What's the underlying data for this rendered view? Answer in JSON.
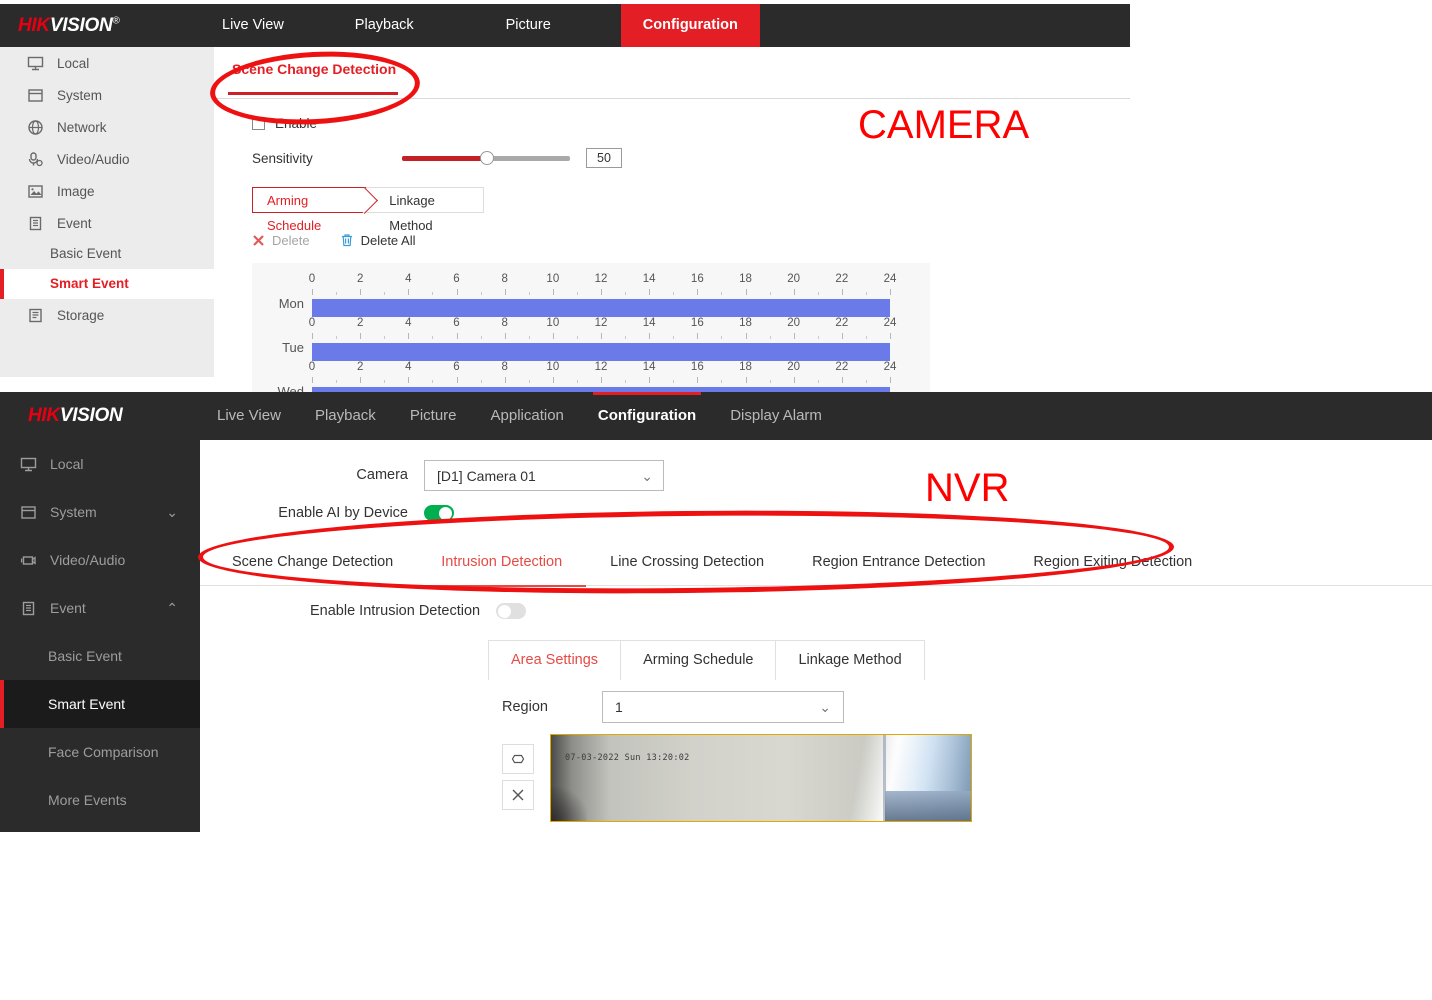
{
  "annotations": {
    "camera_label": "CAMERA",
    "nvr_label": "NVR",
    "accent_red": "#ee1111"
  },
  "camera_panel": {
    "brand": {
      "hik": "HIK",
      "vision": "VISION",
      "reg": "®"
    },
    "nav": [
      {
        "label": "Live View",
        "active": false
      },
      {
        "label": "Playback",
        "active": false
      },
      {
        "label": "Picture",
        "active": false
      },
      {
        "label": "Configuration",
        "active": true
      }
    ],
    "sidebar": [
      {
        "label": "Local",
        "icon": "monitor-icon"
      },
      {
        "label": "System",
        "icon": "window-icon"
      },
      {
        "label": "Network",
        "icon": "globe-icon"
      },
      {
        "label": "Video/Audio",
        "icon": "microphone-icon"
      },
      {
        "label": "Image",
        "icon": "picture-icon"
      },
      {
        "label": "Event",
        "icon": "clipboard-icon"
      }
    ],
    "sidebar_sub": [
      {
        "label": "Basic Event",
        "active": false
      },
      {
        "label": "Smart Event",
        "active": true
      }
    ],
    "sidebar_tail": [
      {
        "label": "Storage",
        "icon": "disk-icon"
      }
    ],
    "page_tab": "Scene Change Detection",
    "enable_label": "Enable",
    "enable_checked": false,
    "sensitivity_label": "Sensitivity",
    "sensitivity_value": "50",
    "sub_tabs": [
      {
        "label": "Arming Schedule",
        "active": true
      },
      {
        "label": "Linkage Method",
        "active": false
      }
    ],
    "actions": {
      "delete": "Delete",
      "delete_all": "Delete All"
    },
    "schedule": {
      "tick_labels": [
        "0",
        "2",
        "4",
        "6",
        "8",
        "10",
        "12",
        "14",
        "16",
        "18",
        "20",
        "22",
        "24"
      ],
      "days": [
        {
          "day": "Mon",
          "start": 0,
          "end": 24
        },
        {
          "day": "Tue",
          "start": 0,
          "end": 24
        },
        {
          "day": "Wed",
          "start": 0,
          "end": 24
        }
      ],
      "bar_color": "#6a7ae8"
    }
  },
  "nvr_panel": {
    "brand": {
      "hik": "HIK",
      "vision": "VISION"
    },
    "nav": [
      {
        "label": "Live View",
        "active": false
      },
      {
        "label": "Playback",
        "active": false
      },
      {
        "label": "Picture",
        "active": false
      },
      {
        "label": "Application",
        "active": false
      },
      {
        "label": "Configuration",
        "active": true
      },
      {
        "label": "Display Alarm",
        "active": false
      }
    ],
    "sidebar": [
      {
        "label": "Local",
        "icon": "monitor-icon",
        "chevron": ""
      },
      {
        "label": "System",
        "icon": "window-icon",
        "chevron": "⌄"
      },
      {
        "label": "Video/Audio",
        "icon": "camera-icon",
        "chevron": ""
      },
      {
        "label": "Event",
        "icon": "clipboard-icon",
        "chevron": "⌃"
      }
    ],
    "sidebar_sub": [
      {
        "label": "Basic Event",
        "active": false
      },
      {
        "label": "Smart Event",
        "active": true
      },
      {
        "label": "Face Comparison",
        "active": false
      },
      {
        "label": "More Events",
        "active": false
      }
    ],
    "camera_label": "Camera",
    "camera_value": "[D1] Camera 01",
    "enable_ai_label": "Enable AI by Device",
    "enable_ai_on": true,
    "detection_tabs": [
      {
        "label": "Scene Change Detection",
        "active": false
      },
      {
        "label": "Intrusion Detection",
        "active": true
      },
      {
        "label": "Line Crossing Detection",
        "active": false
      },
      {
        "label": "Region Entrance Detection",
        "active": false
      },
      {
        "label": "Region Exiting Detection",
        "active": false
      }
    ],
    "enable_intrusion_label": "Enable Intrusion Detection",
    "enable_intrusion_on": false,
    "area_tabs": [
      {
        "label": "Area Settings",
        "active": true
      },
      {
        "label": "Arming Schedule",
        "active": false
      },
      {
        "label": "Linkage Method",
        "active": false
      }
    ],
    "region_label": "Region",
    "region_value": "1",
    "preview_tools": [
      {
        "icon": "hexagon-draw-icon"
      },
      {
        "icon": "clear-x-icon"
      }
    ],
    "video_timestamp": "07-03-2022 Sun 13:20:02"
  }
}
